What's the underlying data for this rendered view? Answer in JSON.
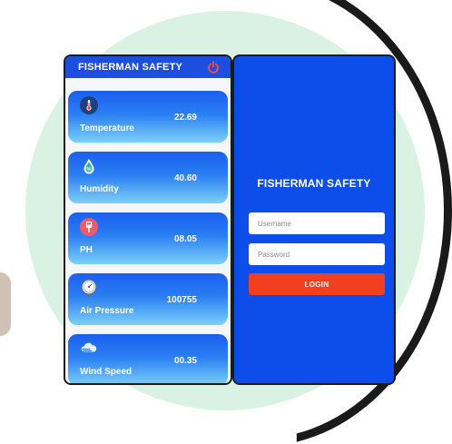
{
  "dashboard": {
    "title": "FISHERMAN SAFETY",
    "cards": [
      {
        "label": "Temperature",
        "value": "22.69",
        "icon": "thermometer-icon"
      },
      {
        "label": "Humidity",
        "value": "40.60",
        "icon": "humidity-drop-icon"
      },
      {
        "label": "PH",
        "value": "08.05",
        "icon": "ph-meter-icon"
      },
      {
        "label": "Air Pressure",
        "value": "100755",
        "icon": "pressure-gauge-icon"
      },
      {
        "label": "Wind Speed",
        "value": "00.35",
        "icon": "wind-cloud-icon"
      }
    ]
  },
  "login": {
    "title": "FISHERMAN SAFETY",
    "username_placeholder": "Username",
    "password_placeholder": "Password",
    "button_label": "LOGIN"
  },
  "colors": {
    "app_bar": "#1d4fde",
    "login_bg": "#0d4eea",
    "login_button": "#f0401f",
    "power_icon": "#ff4a3a",
    "backdrop_circle": "#d9f2e3"
  }
}
